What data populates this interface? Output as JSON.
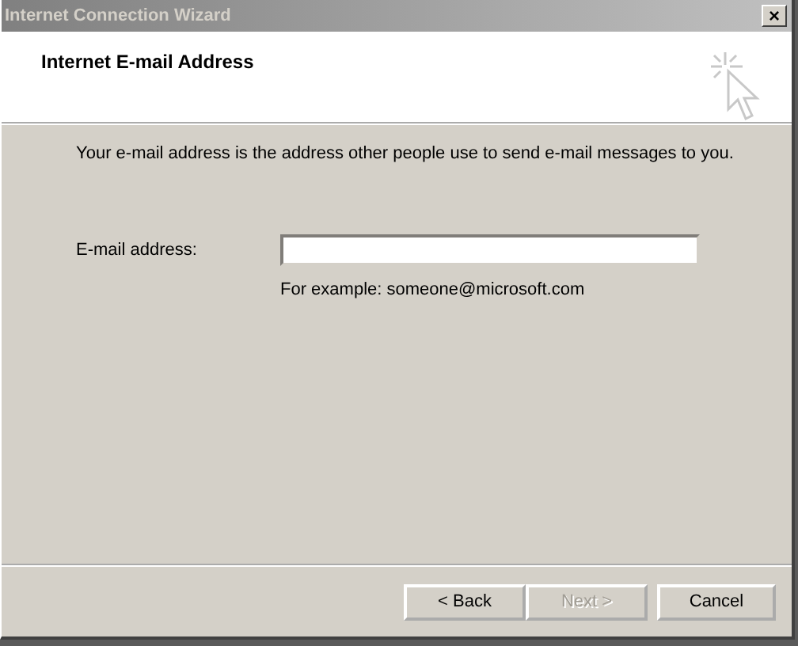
{
  "window": {
    "title": "Internet Connection Wizard",
    "close": "×"
  },
  "header": {
    "title": "Internet E-mail Address"
  },
  "description": "Your e-mail address is the address other people use to send e-mail messages to you.",
  "field": {
    "label": "E-mail address:",
    "hint": "For example: someone@microsoft.com"
  },
  "buttons": [
    {
      "label": "< Back",
      "disabled": false
    },
    {
      "label": "Next >",
      "disabled": true
    },
    {
      "label": "Cancel",
      "disabled": false
    }
  ]
}
